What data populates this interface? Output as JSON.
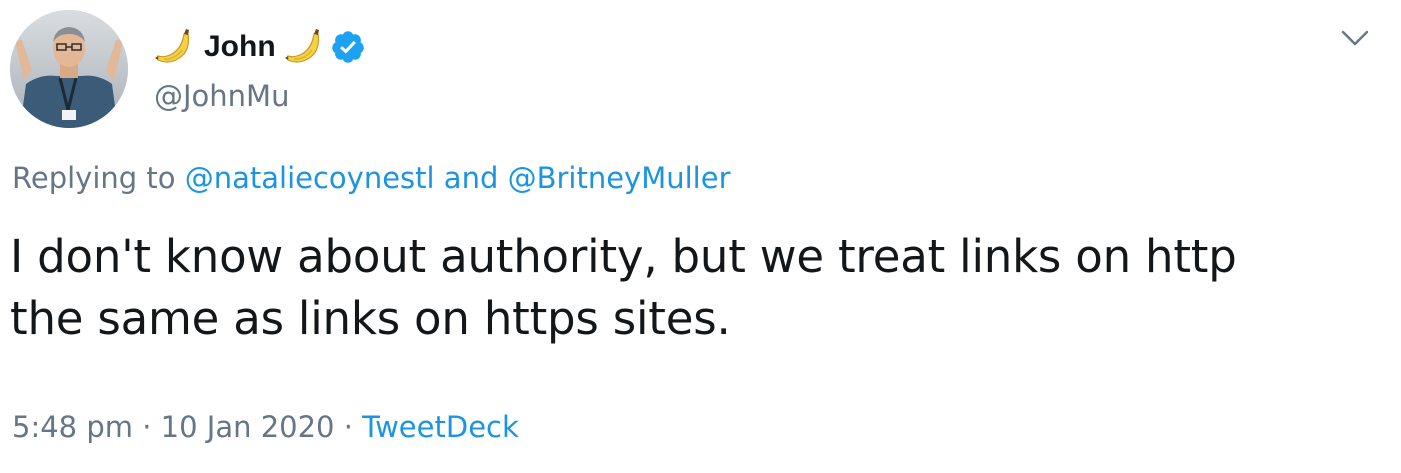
{
  "author": {
    "name": "John",
    "handle": "@JohnMu",
    "name_emoji": "banana-icon",
    "verified": true
  },
  "reply": {
    "prefix": "Replying to",
    "mention_1": "@nataliecoynestl",
    "conjunction": "and",
    "mention_2": "@BritneyMuller"
  },
  "tweet": {
    "line_1": "I don't know about authority, but we treat links on http",
    "line_2": "the same as links on https sites."
  },
  "meta": {
    "time": "5:48 pm",
    "separator": "·",
    "date": "10 Jan 2020",
    "source": "TweetDeck"
  },
  "colors": {
    "link": "#1b95e0",
    "secondary_text": "#657786",
    "primary_text": "#14171a",
    "verified_badge": "#1da1f2"
  }
}
